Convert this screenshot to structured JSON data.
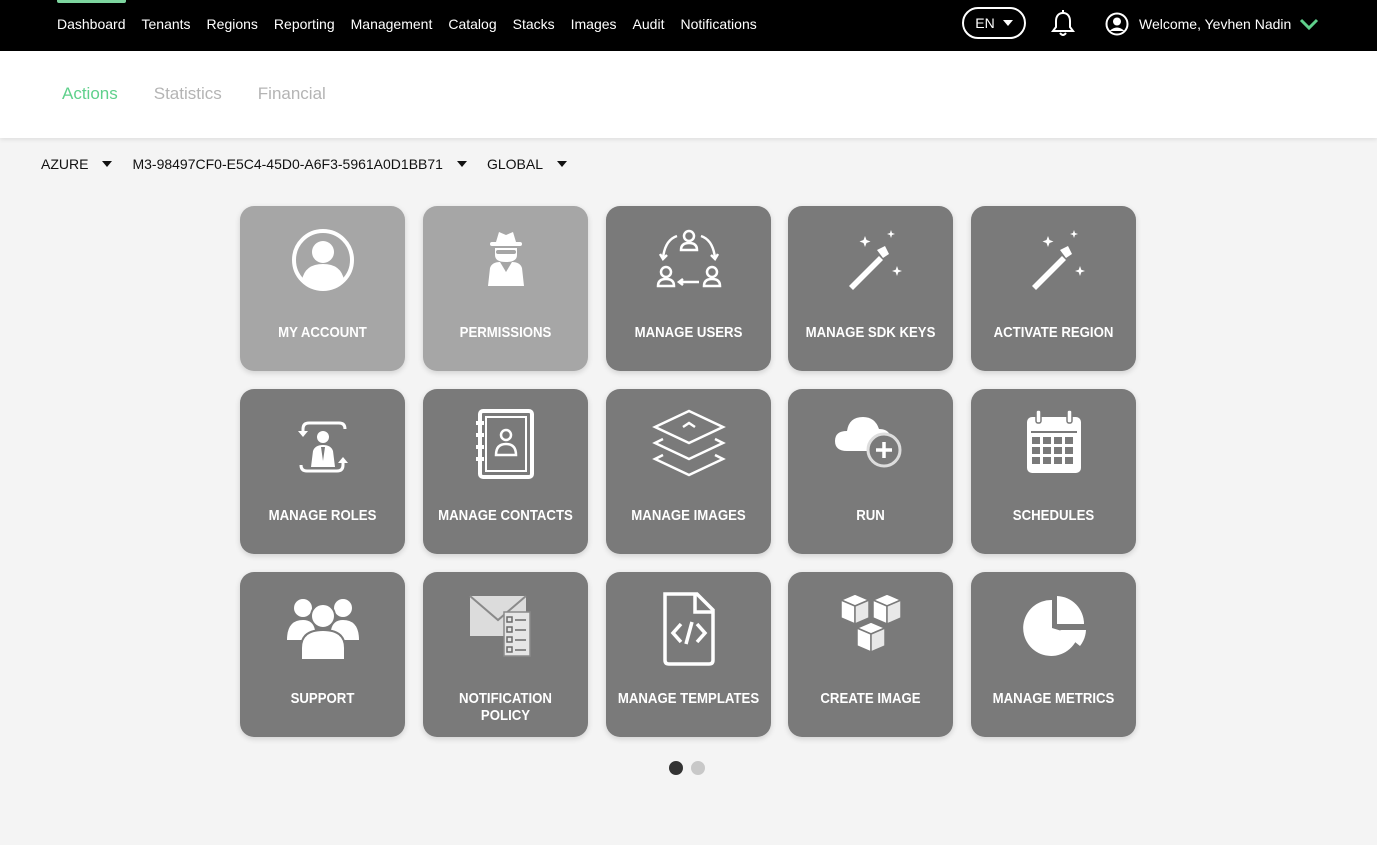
{
  "nav": {
    "items": [
      "Dashboard",
      "Tenants",
      "Regions",
      "Reporting",
      "Management",
      "Catalog",
      "Stacks",
      "Images",
      "Audit",
      "Notifications"
    ],
    "active": "Dashboard"
  },
  "lang": {
    "value": "EN"
  },
  "user": {
    "welcome": "Welcome, Yevhen Nadin"
  },
  "subtabs": {
    "items": [
      "Actions",
      "Statistics",
      "Financial"
    ],
    "active": "Actions"
  },
  "filters": {
    "cloud": "AZURE",
    "account": "M3-98497CF0-E5C4-45D0-A6F3-5961A0D1BB71",
    "scope": "GLOBAL"
  },
  "tiles": [
    {
      "label": "MY ACCOUNT",
      "icon": "account-icon"
    },
    {
      "label": "PERMISSIONS",
      "icon": "spy-icon"
    },
    {
      "label": "MANAGE USERS",
      "icon": "users-cycle-icon"
    },
    {
      "label": "MANAGE SDK KEYS",
      "icon": "magic-wand-icon"
    },
    {
      "label": "ACTIVATE REGION",
      "icon": "magic-wand-icon"
    },
    {
      "label": "MANAGE ROLES",
      "icon": "role-switch-icon"
    },
    {
      "label": "MANAGE CONTACTS",
      "icon": "contact-book-icon"
    },
    {
      "label": "MANAGE IMAGES",
      "icon": "layers-icon"
    },
    {
      "label": "RUN",
      "icon": "cloud-plus-icon"
    },
    {
      "label": "SCHEDULES",
      "icon": "calendar-icon"
    },
    {
      "label": "SUPPORT",
      "icon": "group-icon"
    },
    {
      "label": "NOTIFICATION POLICY",
      "icon": "mail-checklist-icon"
    },
    {
      "label": "MANAGE TEMPLATES",
      "icon": "code-file-icon"
    },
    {
      "label": "CREATE IMAGE",
      "icon": "cubes-icon"
    },
    {
      "label": "MANAGE METRICS",
      "icon": "pie-chart-icon"
    }
  ],
  "pager": {
    "pages": 2,
    "current": 1
  },
  "colors": {
    "accent": "#5fd08b",
    "tile": "#7a7a7a",
    "tile_disabled": "#a6a6a6"
  }
}
